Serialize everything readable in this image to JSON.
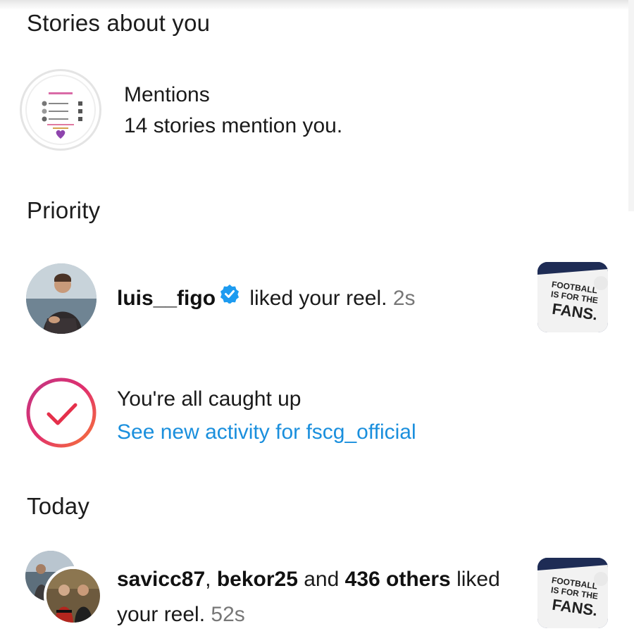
{
  "sections": {
    "stories_about_you": "Stories about you",
    "priority": "Priority",
    "today": "Today"
  },
  "mentions": {
    "title": "Mentions",
    "subtitle": "14 stories mention you."
  },
  "priority_item": {
    "username": "luis__figo",
    "action": "liked your reel.",
    "time": "2s",
    "thumbnail_text": [
      "FOOTBALL",
      "IS FOR THE",
      "FANS."
    ]
  },
  "caught_up": {
    "title": "You're all caught up",
    "link": "See new activity for fscg_official"
  },
  "today_item": {
    "user1": "savicc87",
    "separator": ",",
    "user2": "bekor25",
    "and_text": "and",
    "others": "436 others",
    "action_line1": "liked",
    "action_line2": "your reel.",
    "time": "52s",
    "thumbnail_text": [
      "FOOTBALL",
      "IS FOR THE",
      "FANS."
    ]
  },
  "colors": {
    "link": "#1a8fdd",
    "verified": "#1d9bf0",
    "gradient_start": "#c13584",
    "gradient_end": "#f77737",
    "check": "#e1306c"
  }
}
